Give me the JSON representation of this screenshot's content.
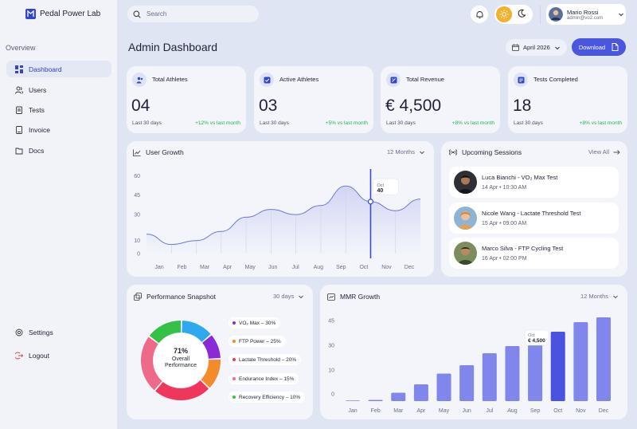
{
  "brand": {
    "name": "Pedal Power Lab"
  },
  "sidebar": {
    "section_title": "Overview",
    "items": [
      {
        "label": "Dashboard",
        "icon": "grid-icon",
        "active": true
      },
      {
        "label": "Users",
        "icon": "users-icon"
      },
      {
        "label": "Tests",
        "icon": "clipboard-icon"
      },
      {
        "label": "Invoice",
        "icon": "invoice-icon"
      },
      {
        "label": "Docs",
        "icon": "folder-icon"
      }
    ],
    "bottom": [
      {
        "label": "Settings",
        "icon": "gear-icon"
      },
      {
        "label": "Logout",
        "icon": "logout-icon"
      }
    ]
  },
  "topbar": {
    "search_placeholder": "Search",
    "user": {
      "name": "Mario Rossi",
      "email": "admin@vo2.com"
    }
  },
  "header": {
    "title": "Admin Dashboard",
    "date": "April 2026",
    "download_label": "Download"
  },
  "stats": [
    {
      "title": "Total Athletes",
      "value": "04",
      "sub": "Last 30 days",
      "change": "+12% vs last month",
      "icon": "users-icon"
    },
    {
      "title": "Active Athletes",
      "value": "03",
      "sub": "Last 30 days",
      "change": "+5% vs last month",
      "icon": "check-icon"
    },
    {
      "title": "Total Revenue",
      "value": "€ 4,500",
      "sub": "Last 30 days",
      "change": "+8% vs last month",
      "icon": "money-icon"
    },
    {
      "title": "Tests Completed",
      "value": "18",
      "sub": "Last 30 days",
      "change": "+8% vs last month",
      "icon": "list-icon"
    }
  ],
  "user_growth": {
    "title": "User Growth",
    "filter": "12 Months",
    "tooltip": {
      "month": "Oct",
      "value": "40"
    }
  },
  "sessions": {
    "title": "Upcoming Sessions",
    "view_all": "View All",
    "items": [
      {
        "name": "Luca Bianchi - VO₂ Max Test",
        "time": "14 Apr • 10:30 AM"
      },
      {
        "name": "Nicole Wang - Lactate Threshold Test",
        "time": "15 Apr • 09:00 AM"
      },
      {
        "name": "Marco Silva - FTP Cycling Test",
        "time": "16 Apr • 02:00 PM"
      }
    ]
  },
  "performance": {
    "title": "Performance Snapshot",
    "filter": "30 days",
    "center_value": "71%",
    "center_label_1": "Overall",
    "center_label_2": "Performance",
    "legend": [
      {
        "label": "VO₂ Max – 30%",
        "color": "#8a2ad6"
      },
      {
        "label": "FTP Power – 25%",
        "color": "#f58a2a"
      },
      {
        "label": "Lactate Threshold – 20%",
        "color": "#f0365a"
      },
      {
        "label": "Endurance Index – 15%",
        "color": "#ee6a8a"
      },
      {
        "label": "Recovery Efficiency – 10%",
        "color": "#35c048"
      }
    ]
  },
  "mmr": {
    "title": "MMR Growth",
    "filter": "12 Months",
    "tooltip": {
      "month": "Oct",
      "value": "€ 4,500"
    }
  },
  "chart_data": [
    {
      "type": "line",
      "x": [
        "Jan",
        "Feb",
        "Mar",
        "Apr",
        "May",
        "Jun",
        "Jul",
        "Aug",
        "Sep",
        "Oct",
        "Nov",
        "Dec"
      ],
      "series": [
        {
          "values": [
            15,
            7,
            10,
            17,
            28,
            34,
            30,
            37,
            52,
            40,
            33,
            42
          ]
        }
      ],
      "yticks": [
        0,
        10,
        30,
        45,
        60
      ],
      "ylim": [
        0,
        62
      ],
      "highlight": "Oct"
    },
    {
      "type": "bar",
      "categories": [
        "Jan",
        "Feb",
        "Mar",
        "Apr",
        "May",
        "Jun",
        "Jul",
        "Aug",
        "Sep",
        "Oct",
        "Nov",
        "Dec"
      ],
      "values": [
        0,
        0.5,
        3.5,
        7,
        11.5,
        15,
        20,
        23,
        23.5,
        29,
        33,
        35
      ],
      "yticks": [
        0,
        10,
        30,
        45
      ],
      "highlight": "Oct"
    },
    {
      "type": "pie",
      "categories": [
        "VO₂ Max",
        "FTP Power",
        "Lactate Threshold",
        "Endurance Index",
        "Recovery Efficiency"
      ],
      "values": [
        30,
        25,
        20,
        15,
        10
      ]
    }
  ]
}
